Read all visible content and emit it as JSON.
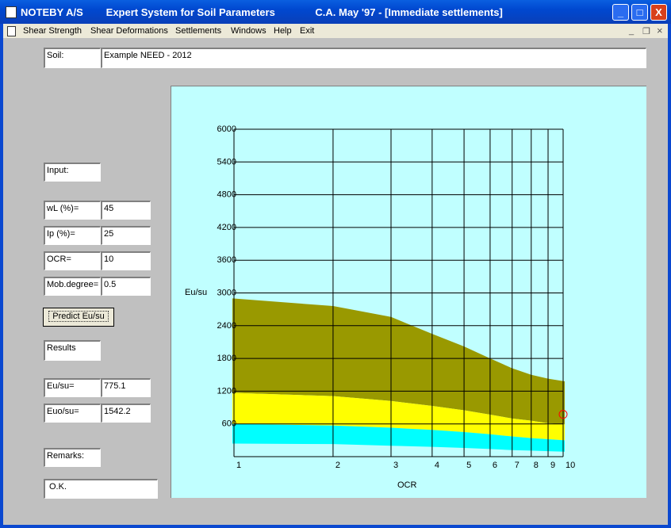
{
  "window": {
    "app": "NOTEBY A/S",
    "system": "Expert System for Soil Parameters",
    "credit": "C.A. May '97 - [Immediate settlements]",
    "buttons": {
      "minimize": "_",
      "maximize": "□",
      "close": "X"
    }
  },
  "menu": [
    "Shear Strength",
    "Shear Deformations",
    "Settlements",
    "Windows",
    "Help",
    "Exit"
  ],
  "mdi_buttons": {
    "minimize": "_",
    "restore": "❐",
    "close": "×"
  },
  "soil": {
    "label": "Soil:",
    "value": "Example NEED - 2012"
  },
  "input": {
    "heading": "Input:",
    "fields": [
      {
        "label": "wL (%)=",
        "value": "45"
      },
      {
        "label": "Ip (%)=",
        "value": "25"
      },
      {
        "label": "OCR=",
        "value": "10"
      },
      {
        "label": "Mob.degree=",
        "value": "0.5"
      }
    ]
  },
  "predict_button": "Predict Eu/su",
  "results": {
    "heading": "Results",
    "fields": [
      {
        "label": "Eu/su=",
        "value": "775.1"
      },
      {
        "label": "Euo/su=",
        "value": "1542.2"
      }
    ]
  },
  "remarks": {
    "label": "Remarks:",
    "value": "O.K."
  },
  "chart_data": {
    "type": "area",
    "xlabel": "OCR",
    "ylabel": "Eu/su",
    "x_scale": "log",
    "xlim": [
      1,
      10
    ],
    "ylim": [
      0,
      6000
    ],
    "x_ticks": [
      "1",
      "2",
      "3",
      "4",
      "5",
      "6",
      "7",
      "8",
      "9",
      "10"
    ],
    "y_ticks": [
      "600",
      "1200",
      "1800",
      "2400",
      "3000",
      "3600",
      "4200",
      "4800",
      "5400",
      "6000"
    ],
    "grid": true,
    "x": [
      1,
      2,
      3,
      4,
      5,
      6,
      7,
      8,
      9,
      10
    ],
    "bands": [
      {
        "color": "#999900",
        "upper": [
          2900,
          2760,
          2560,
          2250,
          2020,
          1800,
          1620,
          1500,
          1430,
          1380
        ],
        "lower": [
          1170,
          1110,
          1020,
          930,
          850,
          770,
          700,
          660,
          610,
          590
        ]
      },
      {
        "color": "#ffff00",
        "upper": [
          1170,
          1110,
          1020,
          930,
          850,
          770,
          700,
          660,
          610,
          590
        ],
        "lower": [
          600,
          570,
          530,
          490,
          450,
          410,
          370,
          340,
          320,
          300
        ]
      },
      {
        "color": "#00ffff",
        "upper": [
          600,
          570,
          530,
          490,
          450,
          410,
          370,
          340,
          320,
          300
        ],
        "lower": [
          240,
          230,
          200,
          180,
          160,
          140,
          120,
          110,
          100,
          90
        ]
      }
    ],
    "point": {
      "x": 10,
      "y": 775.1,
      "color": "#ff0000"
    }
  }
}
